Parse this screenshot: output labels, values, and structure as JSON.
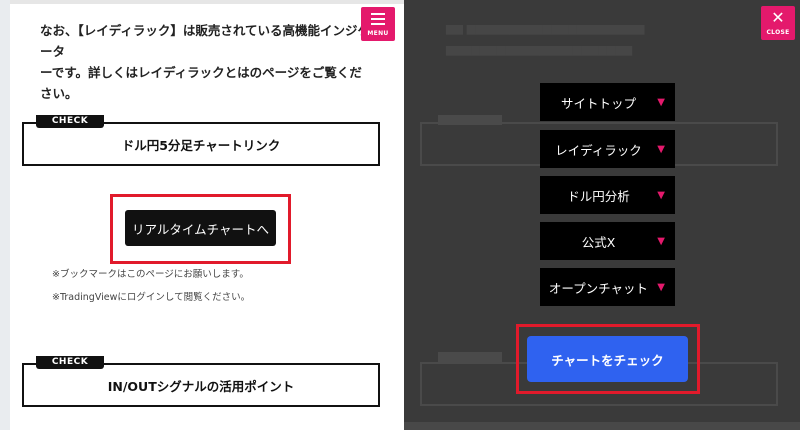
{
  "left": {
    "intro_line1": "なお、【レイディラック】は販売されている高機能インジケータ",
    "intro_line2": "ーです。詳しくはレイディラックとはのページをご覧ください。",
    "check_tag": "CHECK",
    "section1_title": "ドル円5分足チャートリンク",
    "realtime_button": "リアルタイムチャートへ",
    "note1": "※ブックマークはこのページにお願いします。",
    "note2": "※TradingViewにログインして閲覧ください。",
    "section2_title": "IN/OUTシグナルの活用ポイント"
  },
  "menu_button": {
    "icon": "hamburger-icon",
    "label": "MENU"
  },
  "close_button": {
    "icon": "close-icon",
    "label": "CLOSE"
  },
  "nav_menu": {
    "items": [
      {
        "label": "サイトトップ",
        "icon": "triangle-down-icon"
      },
      {
        "label": "レイディラック",
        "icon": "triangle-down-icon"
      },
      {
        "label": "ドル円分析",
        "icon": "triangle-down-icon"
      },
      {
        "label": "公式X",
        "icon": "triangle-down-icon"
      },
      {
        "label": "オープンチャット",
        "icon": "triangle-down-icon"
      }
    ],
    "arrow_glyph": "▼",
    "cta_label": "チャートをチェック"
  },
  "colors": {
    "accent_pink": "#e4196c",
    "highlight_red": "#e11a2b",
    "cta_blue": "#2f62f0",
    "overlay_bg": "#3a3a3a"
  }
}
